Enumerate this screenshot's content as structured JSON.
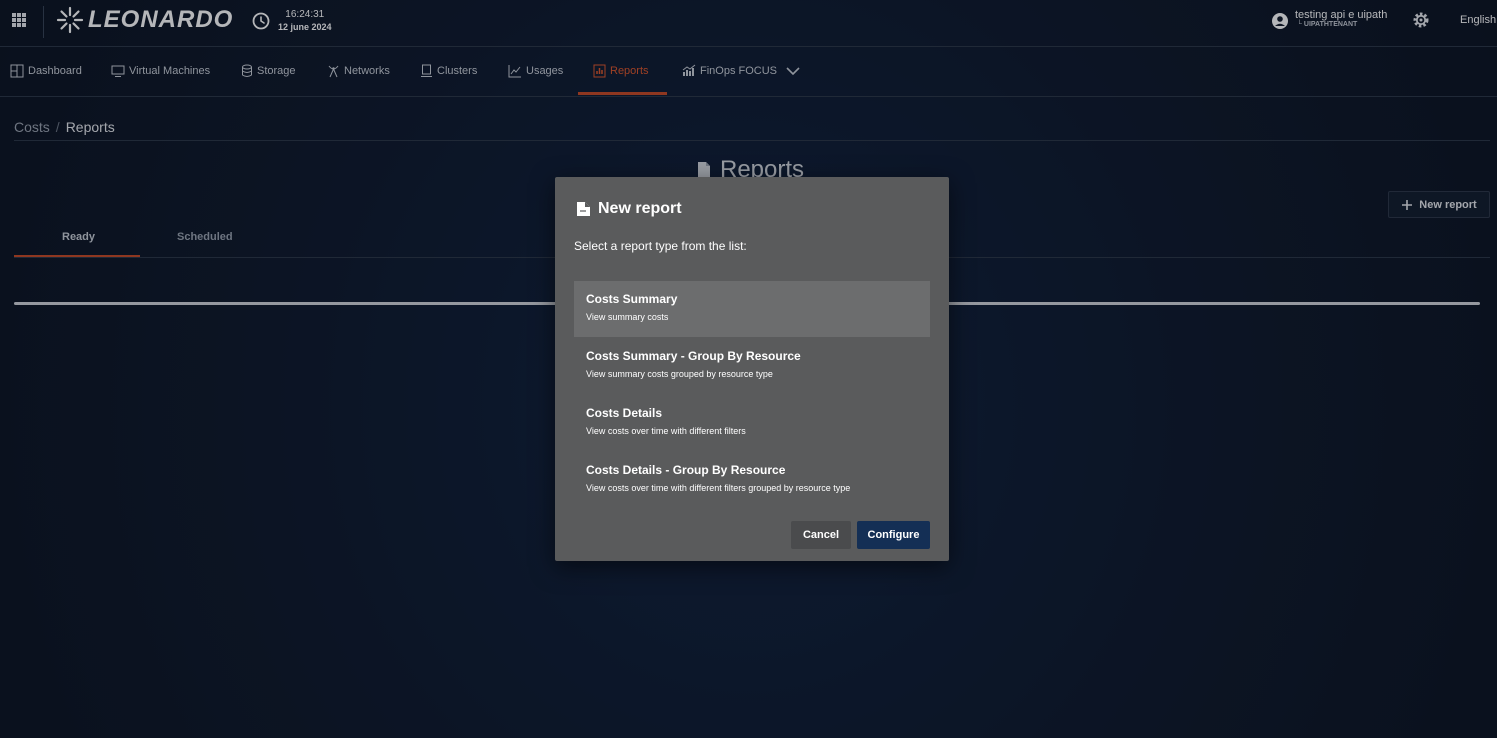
{
  "header": {
    "brand": "LEONARDO",
    "time": "16:24:31",
    "date": "12 june 2024",
    "user_name": "testing api e uipath",
    "tenant": "UIPATHTENANT",
    "language": "English"
  },
  "nav": {
    "items": [
      {
        "label": "Dashboard",
        "icon": "dashboard-icon"
      },
      {
        "label": "Virtual Machines",
        "icon": "monitor-icon"
      },
      {
        "label": "Storage",
        "icon": "database-icon"
      },
      {
        "label": "Networks",
        "icon": "antenna-icon"
      },
      {
        "label": "Clusters",
        "icon": "server-icon"
      },
      {
        "label": "Usages",
        "icon": "line-chart-icon"
      },
      {
        "label": "Reports",
        "icon": "report-icon",
        "active": true
      },
      {
        "label": "FinOps FOCUS",
        "icon": "bar-chart-icon"
      }
    ]
  },
  "breadcrumb": {
    "parent": "Costs",
    "separator": "/",
    "current": "Reports"
  },
  "page": {
    "title": "Reports",
    "new_report_label": "New report",
    "tabs": [
      {
        "label": "Ready",
        "active": true
      },
      {
        "label": "Scheduled"
      }
    ]
  },
  "modal": {
    "title": "New report",
    "subtitle": "Select a report type from the list:",
    "options": [
      {
        "title": "Costs Summary",
        "description": "View summary costs",
        "selected": true
      },
      {
        "title": "Costs Summary - Group By Resource",
        "description": "View summary costs grouped by resource type"
      },
      {
        "title": "Costs Details",
        "description": "View costs over time with different filters"
      },
      {
        "title": "Costs Details - Group By Resource",
        "description": "View costs over time with different filters grouped by resource type"
      }
    ],
    "cancel_label": "Cancel",
    "configure_label": "Configure"
  },
  "colors": {
    "accent": "#c94a25",
    "primary_button": "#142f55",
    "modal_bg": "#5a5b5c"
  }
}
